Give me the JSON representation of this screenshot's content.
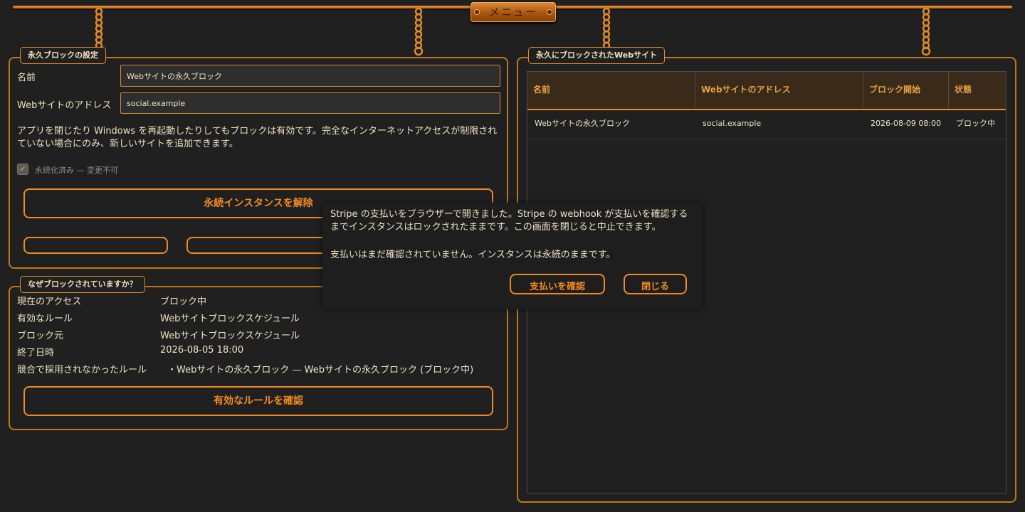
{
  "menu": {
    "label": "メニュー"
  },
  "settings": {
    "legend": "永久ブロックの設定",
    "name_label": "名前",
    "name_value": "Webサイトの永久ブロック",
    "address_label": "Webサイトのアドレス",
    "address_value": "social.example",
    "description": "アプリを閉じたり Windows を再起動したりしてもブロックは有効です。完全なインターネットアクセスが制限されていない場合にのみ、新しいサイトを追加できます。",
    "checkbox_label": "永続化済み — 変更不可",
    "checkbox_checked": true,
    "unlock_button": "永続インスタンスを解除"
  },
  "why": {
    "legend": "なぜブロックされていますか？",
    "rows": [
      {
        "key": "現在のアクセス",
        "value": "ブロック中"
      },
      {
        "key": "有効なルール",
        "value": "Webサイトブロックスケジュール"
      },
      {
        "key": "ブロック元",
        "value": "Webサイトブロックスケジュール"
      },
      {
        "key": "終了日時",
        "value": "2026-08-05 18:00"
      },
      {
        "key": "競合で採用されなかったルール",
        "value": "・Webサイトの永久ブロック — Webサイトの永久ブロック (ブロック中)"
      }
    ],
    "check_button": "有効なルールを確認"
  },
  "blocked": {
    "legend": "永久にブロックされたWebサイト",
    "columns": [
      "名前",
      "Webサイトのアドレス",
      "ブロック開始",
      "状態"
    ],
    "rows": [
      [
        "Webサイトの永久ブロック",
        "social.example",
        "2026-08-09 08:00",
        "ブロック中"
      ]
    ]
  },
  "dialog": {
    "message": "Stripe の支払いをブラウザーで開きました。Stripe の webhook が支払いを確認するまでインスタンスはロックされたままです。この画面を閉じると中止できます。",
    "status": "支払いはまだ確認されていません。インスタンスは永続のままです。",
    "confirm_button": "支払いを確認",
    "close_button": "閉じる"
  },
  "colors": {
    "background": "#202020",
    "accent": "#f08a20",
    "border": "#c4741c",
    "text": "#efe2bf"
  }
}
